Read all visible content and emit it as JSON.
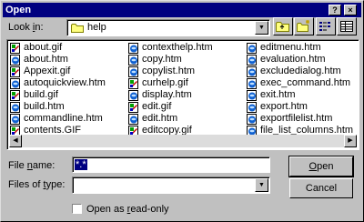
{
  "title": "Open",
  "title_buttons": {
    "help": "?",
    "close": "×"
  },
  "look_in": {
    "label_pre": "Look ",
    "label_acc": "i",
    "label_post": "n:",
    "value": "help"
  },
  "columns": [
    [
      {
        "name": "about.gif",
        "icon": "gif-file-icon"
      },
      {
        "name": "about.htm",
        "icon": "htm-file-icon"
      },
      {
        "name": "Appexit.gif",
        "icon": "gif-file-icon"
      },
      {
        "name": "autoquickview.htm",
        "icon": "htm-file-icon"
      },
      {
        "name": "build.gif",
        "icon": "gif-file-icon"
      },
      {
        "name": "build.htm",
        "icon": "htm-file-icon"
      },
      {
        "name": "commandline.htm",
        "icon": "htm-file-icon"
      },
      {
        "name": "contents.GIF",
        "icon": "gif-file-icon"
      }
    ],
    [
      {
        "name": "contexthelp.htm",
        "icon": "htm-file-icon"
      },
      {
        "name": "copy.htm",
        "icon": "htm-file-icon"
      },
      {
        "name": "copylist.htm",
        "icon": "htm-file-icon"
      },
      {
        "name": "curhelp.gif",
        "icon": "gif-file-icon"
      },
      {
        "name": "display.htm",
        "icon": "htm-file-icon"
      },
      {
        "name": "edit.gif",
        "icon": "gif-file-icon"
      },
      {
        "name": "edit.htm",
        "icon": "htm-file-icon"
      },
      {
        "name": "editcopy.gif",
        "icon": "gif-file-icon"
      }
    ],
    [
      {
        "name": "editmenu.htm",
        "icon": "htm-file-icon"
      },
      {
        "name": "evaluation.htm",
        "icon": "htm-file-icon"
      },
      {
        "name": "excludedialog.htm",
        "icon": "htm-file-icon"
      },
      {
        "name": "exec_command.htm",
        "icon": "htm-file-icon"
      },
      {
        "name": "exit.htm",
        "icon": "htm-file-icon"
      },
      {
        "name": "export.htm",
        "icon": "htm-file-icon"
      },
      {
        "name": "exportfilelist.htm",
        "icon": "htm-file-icon"
      },
      {
        "name": "file_list_columns.htm",
        "icon": "htm-file-icon"
      }
    ]
  ],
  "file_name": {
    "label_pre": "File ",
    "label_acc": "n",
    "label_post": "ame:",
    "value": "*.*"
  },
  "files_of_type": {
    "label_pre": "Files of ",
    "label_acc": "t",
    "label_post": "ype:",
    "value": ""
  },
  "read_only": {
    "label_pre": "Open as ",
    "label_acc": "r",
    "label_post": "ead-only",
    "checked": false
  },
  "buttons": {
    "open_acc": "O",
    "open_rest": "pen",
    "cancel": "Cancel"
  },
  "colors": {
    "titlebar": "#000080",
    "face": "#c0c0c0",
    "selection": "#000080"
  }
}
